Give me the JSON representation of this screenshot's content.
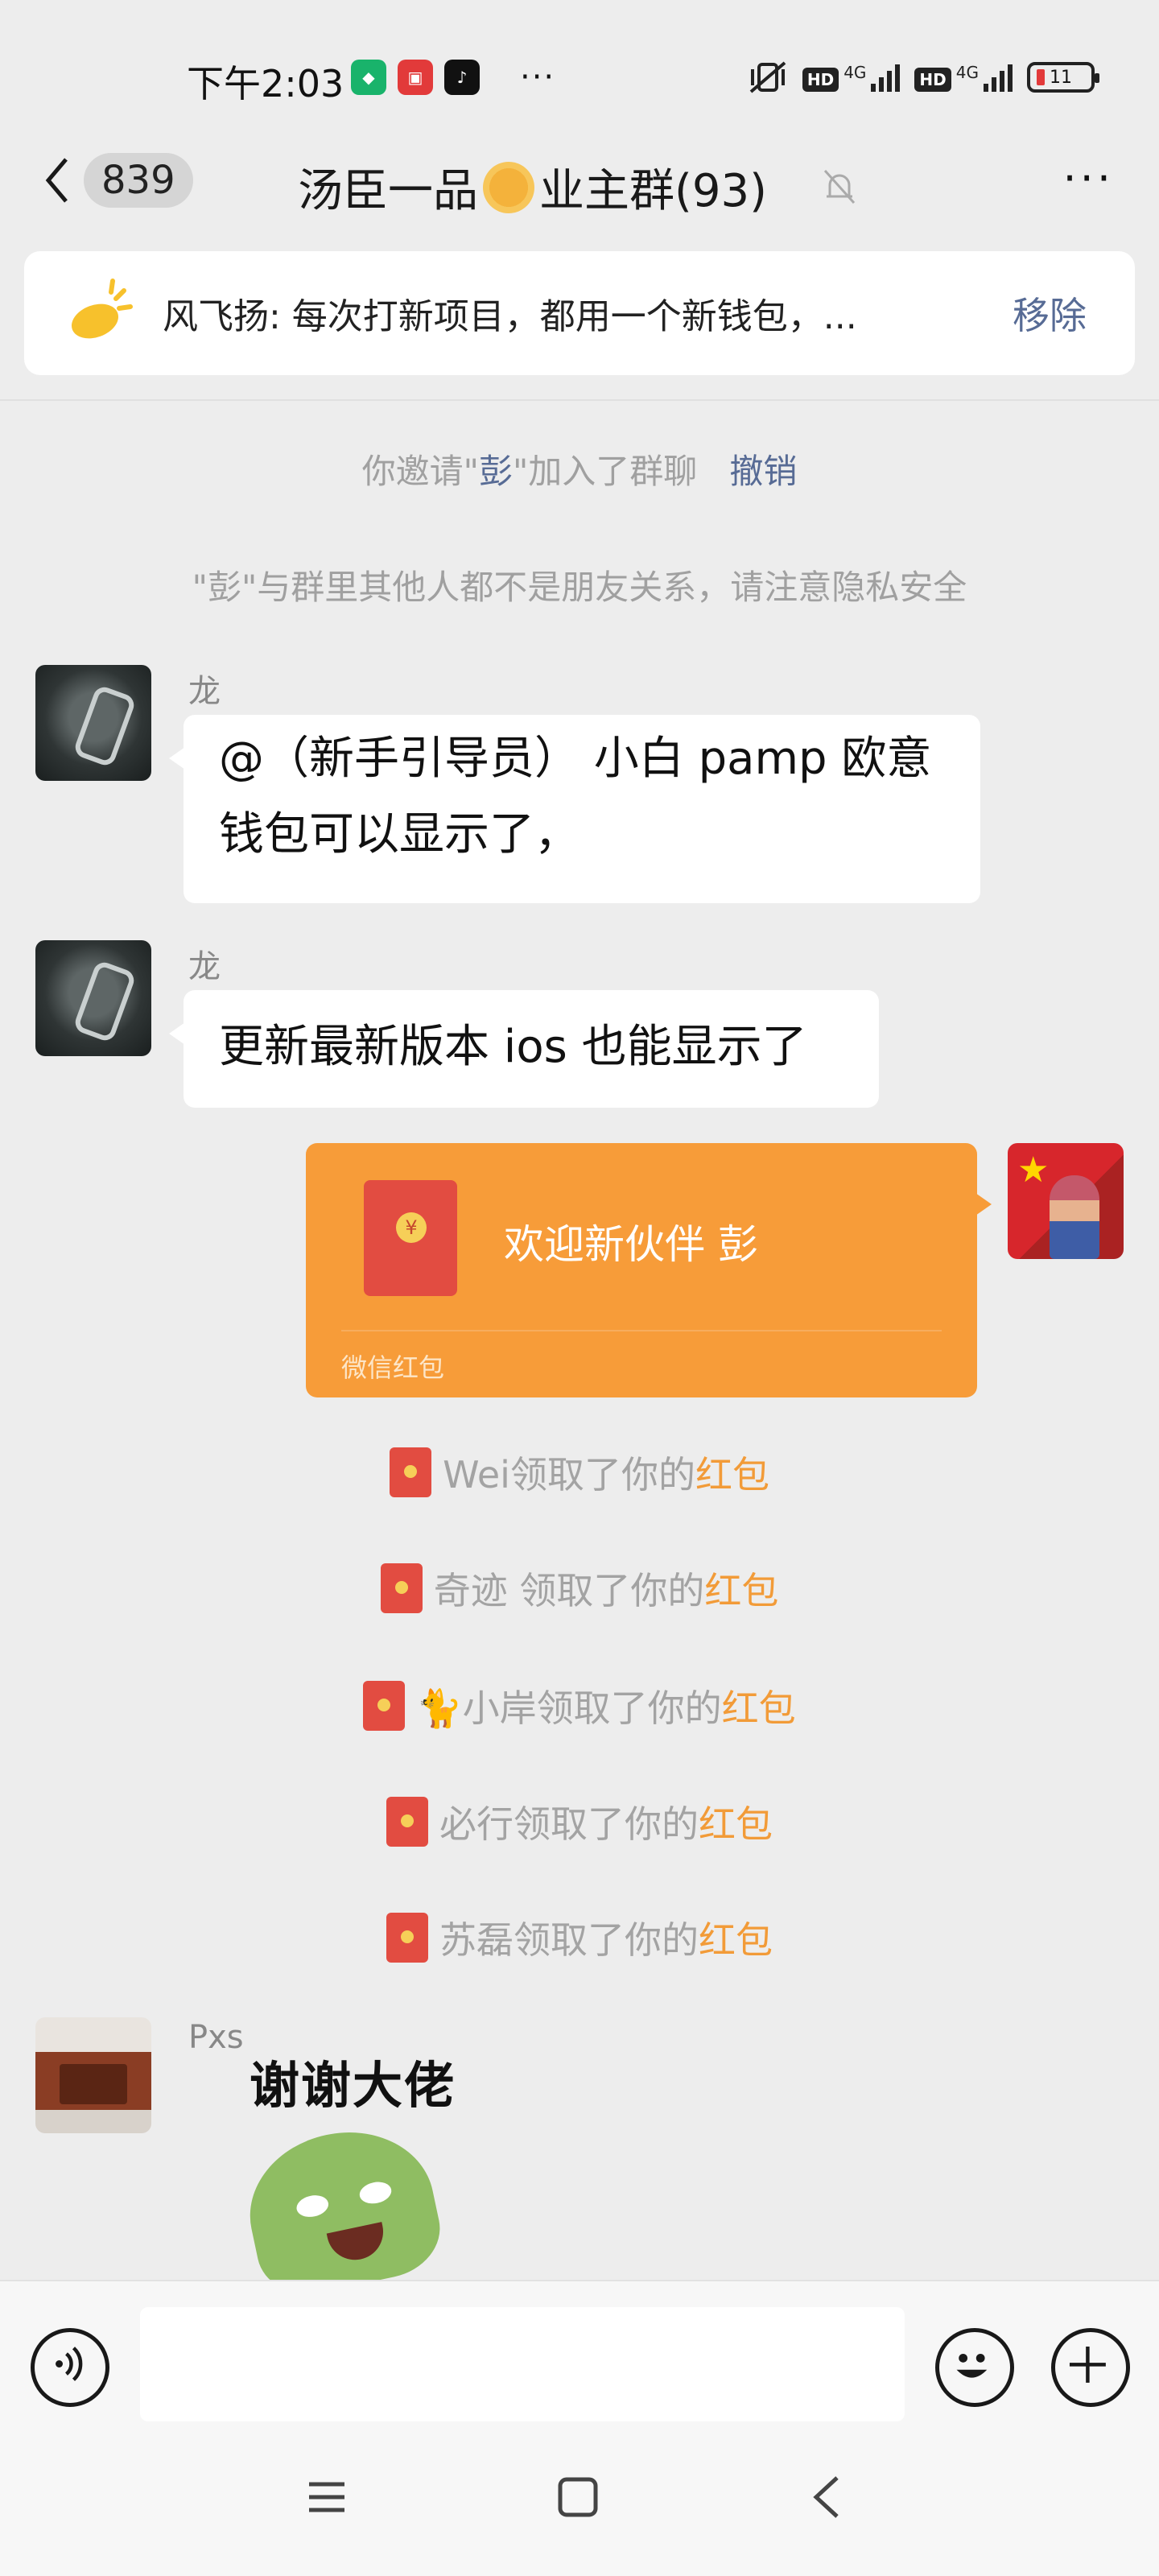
{
  "status_bar": {
    "time": "下午2:03",
    "network_1": "4G",
    "network_2": "4G",
    "hd_1": "HD",
    "hd_2": "HD",
    "battery": "11",
    "more_dots": "···",
    "app_icons": [
      "shield-app-icon",
      "red-app-icon",
      "tiktok-icon"
    ]
  },
  "header": {
    "unread_count": "839",
    "title_prefix": "汤臣一品",
    "title_suffix": "业主群(93)",
    "more": "···"
  },
  "pinned": {
    "text": "风飞扬: 每次打新项目，都用一个新钱包，...",
    "remove_label": "移除"
  },
  "system": {
    "invite_before": "你邀请\"",
    "invite_name": "彭",
    "invite_after": "\"加入了群聊",
    "invite_undo": "撤销",
    "privacy_notice": "\"彭\"与群里其他人都不是朋友关系，请注意隐私安全"
  },
  "messages": [
    {
      "sender": "龙",
      "text_line1": "@（新手引导员） 小白 pamp 欧意",
      "text_line2": "钱包可以显示了，"
    },
    {
      "sender": "龙",
      "text": "更新最新版本 ios 也能显示了"
    },
    {
      "type": "red_packet",
      "title": "欢迎新伙伴  彭",
      "label": "微信红包"
    },
    {
      "sender": "Pxs",
      "sticker_text": "谢谢大佬"
    }
  ],
  "red_packet_receipts": [
    {
      "name": "Wei",
      "text": "领取了你的",
      "link": "红包"
    },
    {
      "name": "奇迹 ",
      "text": "领取了你的",
      "link": "红包"
    },
    {
      "name": "🐈小岸",
      "text": "领取了你的",
      "link": "红包"
    },
    {
      "name": "必行",
      "text": "领取了你的",
      "link": "红包"
    },
    {
      "name": "苏磊",
      "text": "领取了你的",
      "link": "红包"
    }
  ],
  "input": {
    "placeholder": ""
  },
  "colors": {
    "link": "#576b95",
    "red_packet": "#f79c39",
    "background": "#ededed"
  }
}
